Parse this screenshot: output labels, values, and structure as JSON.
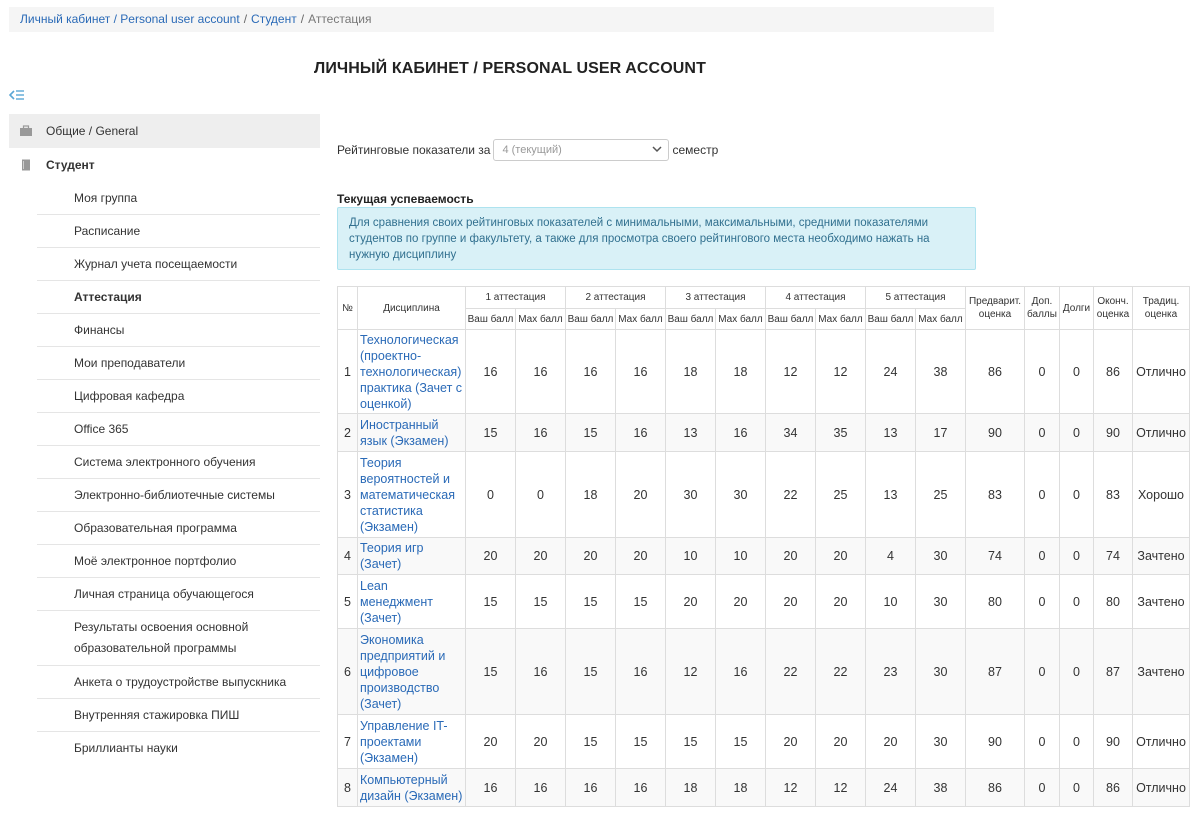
{
  "breadcrumb": {
    "items": [
      "Личный кабинет / Personal user account",
      "Студент"
    ],
    "separator": "/",
    "current": "Аттестация"
  },
  "page_title": "ЛИЧНЫЙ КАБИНЕТ / PERSONAL USER ACCOUNT",
  "sidebar": {
    "general": {
      "label": "Общие / General",
      "icon": "briefcase-icon"
    },
    "student": {
      "label": "Студент",
      "icon": "book-icon"
    },
    "items": [
      {
        "label": "Моя группа"
      },
      {
        "label": "Расписание"
      },
      {
        "label": "Журнал учета посещаемости"
      },
      {
        "label": "Аттестация",
        "active": true
      },
      {
        "label": "Финансы"
      },
      {
        "label": "Мои преподаватели"
      },
      {
        "label": "Цифровая кафедра"
      },
      {
        "label": "Office 365"
      },
      {
        "label": "Система электронного обучения"
      },
      {
        "label": "Электронно-библиотечные системы"
      },
      {
        "label": "Образовательная программа"
      },
      {
        "label": "Моё электронное портфолио"
      },
      {
        "label": "Личная страница обучающегося"
      },
      {
        "label": "Результаты освоения основной образовательной программы"
      },
      {
        "label": "Анкета о трудоустройстве выпускника"
      },
      {
        "label": "Внутренняя стажировка ПИШ"
      },
      {
        "label": "Бриллианты науки"
      }
    ]
  },
  "semester": {
    "prefix": "Рейтинговые показатели за",
    "selected": "4 (текущий)",
    "suffix": "семестр"
  },
  "current_progress": {
    "title": "Текущая успеваемость",
    "info": "Для сравнения своих рейтинговых показателей с минимальными, максимальными, средними показателями студентов по группе и факультету, а также для просмотра своего рейтингового места необходимо нажать на нужную дисциплину"
  },
  "table": {
    "headers": {
      "num": "№",
      "discipline": "Дисциплина",
      "attestations": [
        "1 аттестация",
        "2 аттестация",
        "3 аттестация",
        "4 аттестация",
        "5 аттестация"
      ],
      "your_score": "Ваш балл",
      "max_score": "Max балл",
      "prelim": "Предварит. оценка",
      "extra": "Доп. баллы",
      "debts": "Долги",
      "final": "Оконч. оценка",
      "traditional": "Традиц. оценка"
    },
    "rows": [
      {
        "num": "1",
        "discipline": "Технологическая (проектно-технологическая) практика (Зачет с оценкой)",
        "scores": [
          "16",
          "16",
          "16",
          "16",
          "18",
          "18",
          "12",
          "12",
          "24",
          "38"
        ],
        "prelim": "86",
        "extra": "0",
        "debts": "0",
        "final": "86",
        "traditional": "Отлично"
      },
      {
        "num": "2",
        "discipline": "Иностранный язык (Экзамен)",
        "scores": [
          "15",
          "16",
          "15",
          "16",
          "13",
          "16",
          "34",
          "35",
          "13",
          "17"
        ],
        "prelim": "90",
        "extra": "0",
        "debts": "0",
        "final": "90",
        "traditional": "Отлично"
      },
      {
        "num": "3",
        "discipline": "Теория вероятностей и математическая статистика (Экзамен)",
        "scores": [
          "0",
          "0",
          "18",
          "20",
          "30",
          "30",
          "22",
          "25",
          "13",
          "25"
        ],
        "prelim": "83",
        "extra": "0",
        "debts": "0",
        "final": "83",
        "traditional": "Хорошо"
      },
      {
        "num": "4",
        "discipline": "Теория игр (Зачет)",
        "scores": [
          "20",
          "20",
          "20",
          "20",
          "10",
          "10",
          "20",
          "20",
          "4",
          "30"
        ],
        "prelim": "74",
        "extra": "0",
        "debts": "0",
        "final": "74",
        "traditional": "Зачтено"
      },
      {
        "num": "5",
        "discipline": "Lean менеджмент (Зачет)",
        "scores": [
          "15",
          "15",
          "15",
          "15",
          "20",
          "20",
          "20",
          "20",
          "10",
          "30"
        ],
        "prelim": "80",
        "extra": "0",
        "debts": "0",
        "final": "80",
        "traditional": "Зачтено"
      },
      {
        "num": "6",
        "discipline": "Экономика предприятий и цифровое производство (Зачет)",
        "scores": [
          "15",
          "16",
          "15",
          "16",
          "12",
          "16",
          "22",
          "22",
          "23",
          "30"
        ],
        "prelim": "87",
        "extra": "0",
        "debts": "0",
        "final": "87",
        "traditional": "Зачтено"
      },
      {
        "num": "7",
        "discipline": "Управление IT-проектами (Экзамен)",
        "scores": [
          "20",
          "20",
          "15",
          "15",
          "15",
          "15",
          "20",
          "20",
          "20",
          "30"
        ],
        "prelim": "90",
        "extra": "0",
        "debts": "0",
        "final": "90",
        "traditional": "Отлично"
      },
      {
        "num": "8",
        "discipline": "Компьютерный дизайн (Экзамен)",
        "scores": [
          "16",
          "16",
          "16",
          "16",
          "18",
          "18",
          "12",
          "12",
          "24",
          "38"
        ],
        "prelim": "86",
        "extra": "0",
        "debts": "0",
        "final": "86",
        "traditional": "Отлично"
      }
    ]
  }
}
